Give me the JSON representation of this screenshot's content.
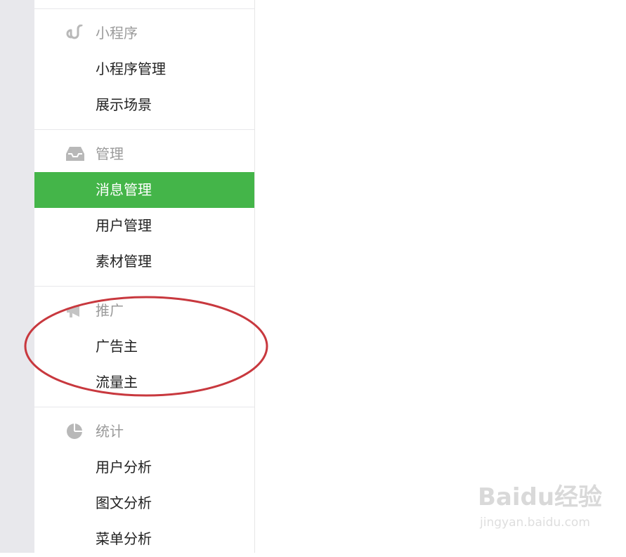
{
  "sidebar": {
    "sections": [
      {
        "title": "小程序",
        "icon": "link-icon",
        "items": [
          {
            "label": "小程序管理"
          },
          {
            "label": "展示场景"
          }
        ]
      },
      {
        "title": "管理",
        "icon": "inbox-icon",
        "items": [
          {
            "label": "消息管理"
          },
          {
            "label": "用户管理"
          },
          {
            "label": "素材管理"
          }
        ]
      },
      {
        "title": "推广",
        "icon": "megaphone-icon",
        "items": [
          {
            "label": "广告主"
          },
          {
            "label": "流量主"
          }
        ]
      },
      {
        "title": "统计",
        "icon": "pie-chart-icon",
        "items": [
          {
            "label": "用户分析"
          },
          {
            "label": "图文分析"
          },
          {
            "label": "菜单分析"
          }
        ]
      }
    ],
    "active_item": "消息管理"
  },
  "colors": {
    "active_bg": "#44b549",
    "annotation": "#c8383e",
    "section_text": "#9a9a9a",
    "item_text": "#222222"
  },
  "watermark": {
    "main": "Baidu经验",
    "sub": "jingyan.baidu.com"
  }
}
